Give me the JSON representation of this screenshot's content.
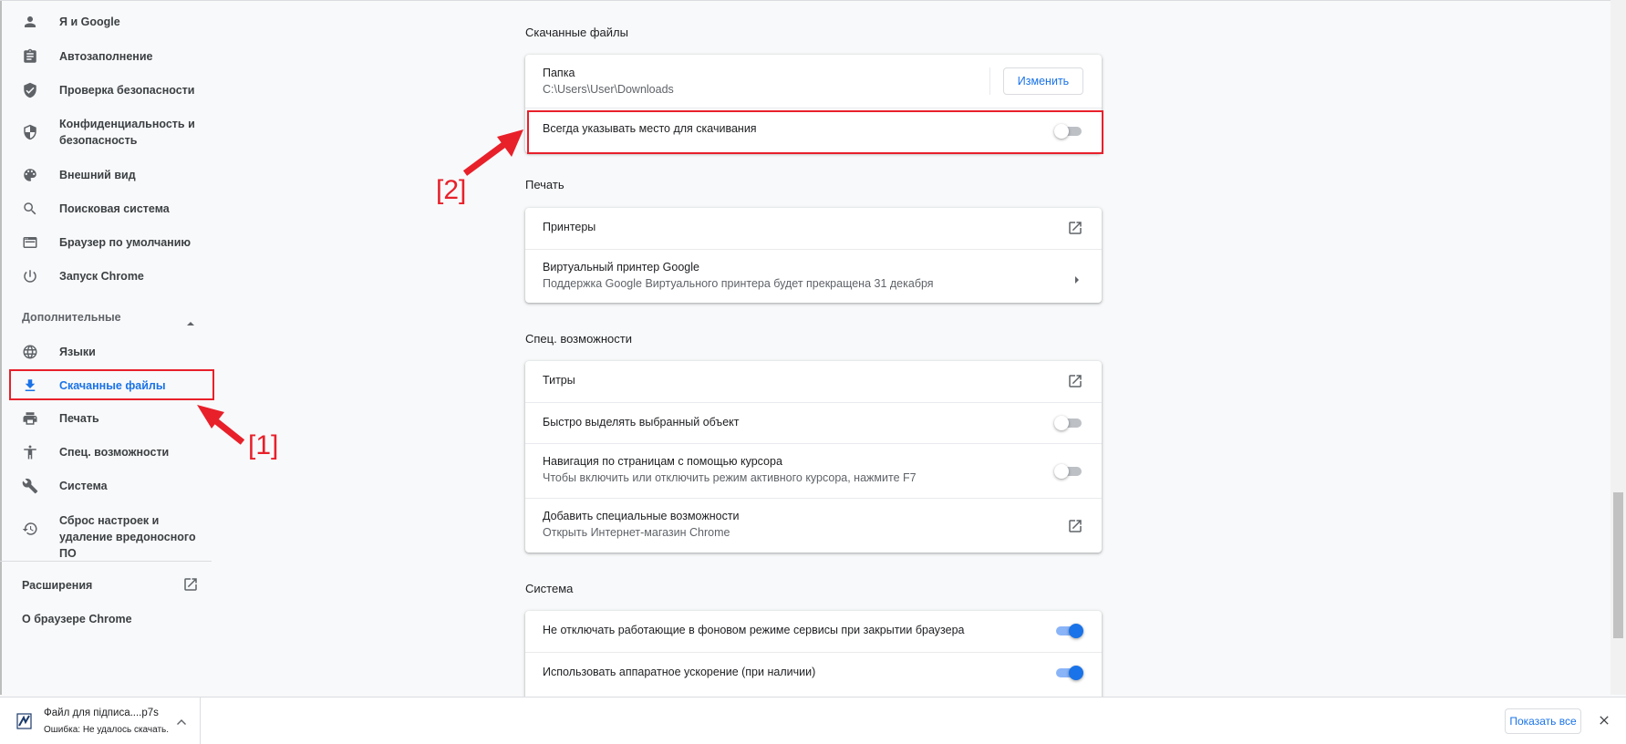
{
  "sidebar": {
    "items": [
      {
        "label": "Я и Google",
        "icon": "person-icon"
      },
      {
        "label": "Автозаполнение",
        "icon": "clipboard-icon"
      },
      {
        "label": "Проверка безопасности",
        "icon": "shield-check-icon"
      },
      {
        "label": "Конфиденциальность и безопасность",
        "icon": "shield-half-icon"
      },
      {
        "label": "Внешний вид",
        "icon": "palette-icon"
      },
      {
        "label": "Поисковая система",
        "icon": "search-icon"
      },
      {
        "label": "Браузер по умолчанию",
        "icon": "browser-icon"
      },
      {
        "label": "Запуск Chrome",
        "icon": "power-icon"
      }
    ],
    "advanced_title": "Дополнительные",
    "advanced_items": [
      {
        "label": "Языки",
        "icon": "globe-icon"
      },
      {
        "label": "Скачанные файлы",
        "icon": "download-icon",
        "active": true
      },
      {
        "label": "Печать",
        "icon": "printer-icon"
      },
      {
        "label": "Спец. возможности",
        "icon": "accessibility-icon"
      },
      {
        "label": "Система",
        "icon": "wrench-icon"
      },
      {
        "label": "Сброс настроек и удаление вредоносного ПО",
        "icon": "restore-icon"
      }
    ],
    "extensions_label": "Расширения",
    "about_label": "О браузере Chrome"
  },
  "downloads": {
    "title": "Скачанные файлы",
    "folder_label": "Папка",
    "folder_path": "C:\\Users\\User\\Downloads",
    "change_button": "Изменить",
    "ask_label": "Всегда указывать место для скачивания",
    "ask_enabled": false
  },
  "print": {
    "title": "Печать",
    "printers_label": "Принтеры",
    "cloud_title": "Виртуальный принтер Google",
    "cloud_sub": "Поддержка Google Виртуального принтера будет прекращена 31 декабря"
  },
  "accessibility": {
    "title": "Спец. возможности",
    "captions_label": "Титры",
    "focus_label": "Быстро выделять выбранный объект",
    "focus_enabled": false,
    "caret_title": "Навигация по страницам с помощью курсора",
    "caret_sub": "Чтобы включить или отключить режим активного курсора, нажмите F7",
    "caret_enabled": false,
    "add_title": "Добавить специальные возможности",
    "add_sub": "Открыть Интернет-магазин Chrome"
  },
  "system": {
    "title": "Система",
    "background_label": "Не отключать работающие в фоновом режиме сервисы при закрытии браузера",
    "background_enabled": true,
    "hw_label": "Использовать аппаратное ускорение (при наличии)",
    "hw_enabled": true
  },
  "annotations": {
    "label1": "[1]",
    "label2": "[2]",
    "color": "#e8202a"
  },
  "download_bar": {
    "file_name": "Файл для підписа....p7s",
    "status": "Ошибка: Не удалось скачать.",
    "show_all": "Показать все"
  },
  "colors": {
    "accent": "#1a73e8",
    "background": "#f8f9fa"
  }
}
